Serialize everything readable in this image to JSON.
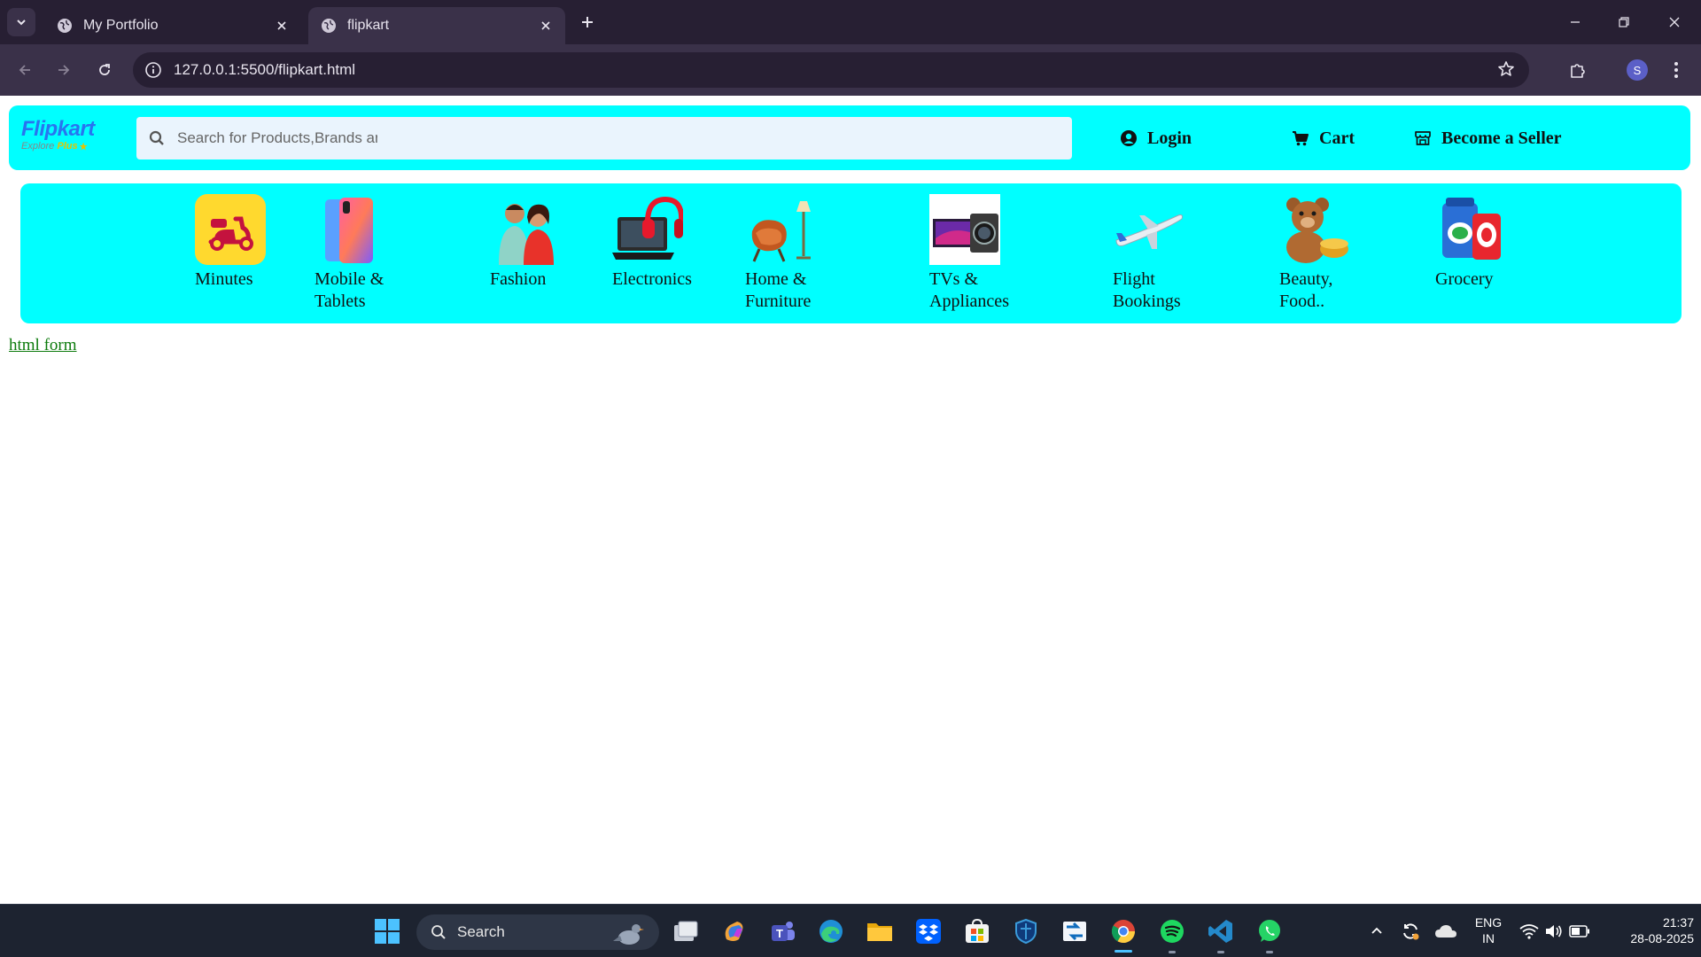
{
  "browser": {
    "tabs": [
      {
        "title": "My Portfolio",
        "active": false
      },
      {
        "title": "flipkart",
        "active": true
      }
    ],
    "url": "127.0.0.1:5500/flipkart.html",
    "profile_initial": "S"
  },
  "header": {
    "logo_text": "Flipkart",
    "logo_tagline": "Explore",
    "logo_plus": "Plus",
    "search_placeholder": "Search for Products,Brands and More",
    "login_label": "Login",
    "cart_label": "Cart",
    "seller_label": "Become a Seller"
  },
  "categories": [
    {
      "label": "Minutes",
      "icon": "scooter-icon"
    },
    {
      "label": "Mobile &\nTablets",
      "icon": "mobile-phone-icon"
    },
    {
      "label": "Fashion",
      "icon": "fashion-couple-icon"
    },
    {
      "label": "Electronics",
      "icon": "laptop-headphones-icon"
    },
    {
      "label": "Home &\nFurniture",
      "icon": "chair-lamp-icon"
    },
    {
      "label": "TVs &\nAppliances",
      "icon": "tv-washer-icon"
    },
    {
      "label": "Flight\nBookings",
      "icon": "airplane-icon"
    },
    {
      "label": "Beauty,\nFood..",
      "icon": "teddy-bear-icon"
    },
    {
      "label": "Grocery",
      "icon": "grocery-pack-icon"
    }
  ],
  "page_link": "html form",
  "taskbar": {
    "search_label": "Search",
    "lang_line1": "ENG",
    "lang_line2": "IN",
    "time": "21:37",
    "date": "28-08-2025"
  },
  "colors": {
    "header_bg": "#00ffff",
    "logo_blue": "#2874f0",
    "link_green": "#0b7a0b"
  }
}
